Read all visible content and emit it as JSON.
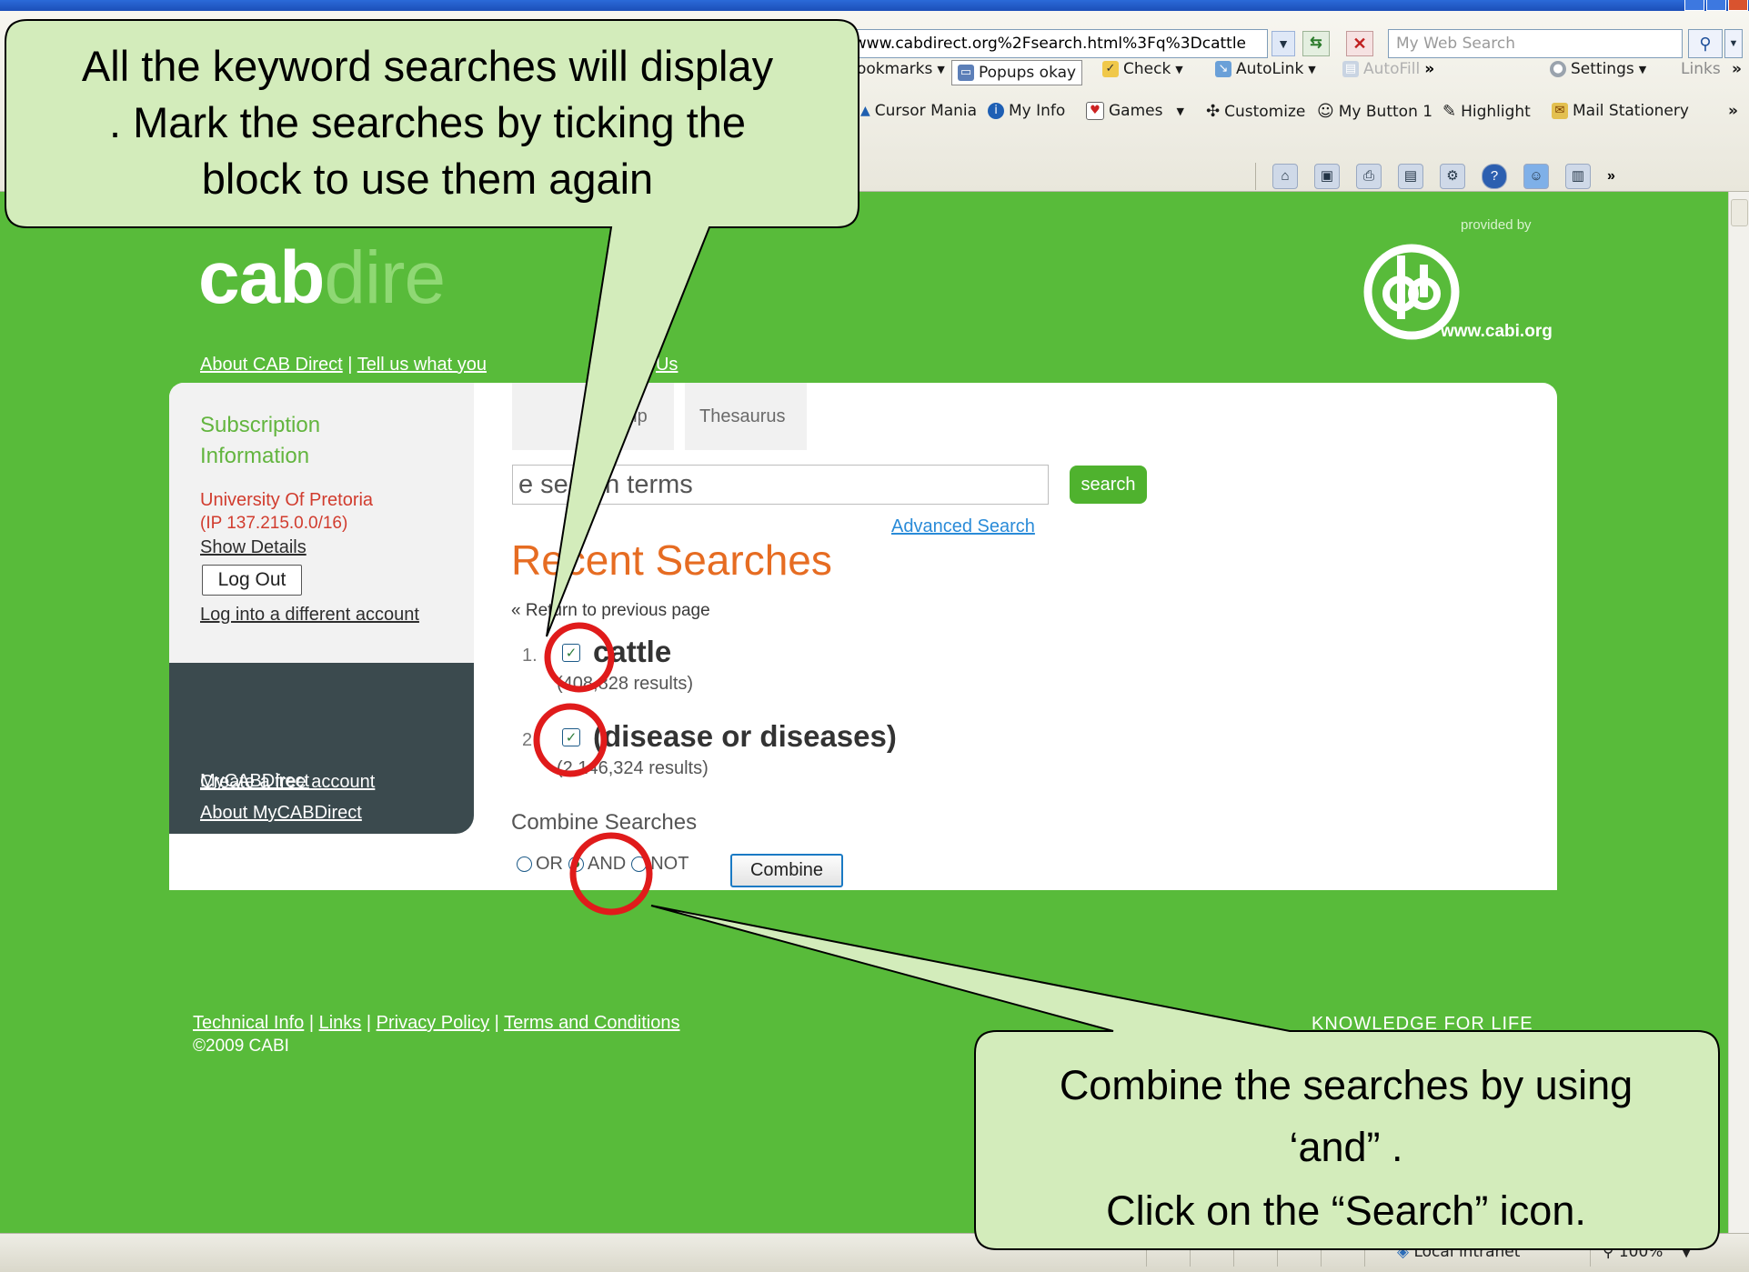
{
  "browser": {
    "address_url": "Fwww.cabdirect.org%2Fsearch.html%3Fq%3Dcattle",
    "web_search_placeholder": "My Web Search",
    "toolbar_row1": {
      "bookmarks": "ookmarks",
      "popups": "Popups okay",
      "check": "Check",
      "autolink": "AutoLink",
      "autofill": "AutoFill",
      "settings": "Settings",
      "links": "Links"
    },
    "toolbar_row2": {
      "cursor_mania": "Cursor Mania",
      "my_info": "My Info",
      "games": "Games",
      "customize": "Customize",
      "my_button": "My Button 1",
      "highlight": "Highlight",
      "mail_stationery": "Mail Stationery"
    },
    "status": {
      "zone": "Local intranet",
      "zoom": "100%"
    }
  },
  "site": {
    "logo_cab": "cab",
    "logo_direct": "dire",
    "provided_by": "provided by",
    "cabi_url": "www.cabi.org",
    "top_nav": {
      "about": "About CAB Direct",
      "tell": "Tell us what you",
      "tail": "Us"
    },
    "sidebar": {
      "subscription_line1": "Subscription",
      "subscription_line2": "Information",
      "institution": "University Of Pretoria",
      "ip": "(IP 137.215.0.0/16)",
      "show_details": "Show Details",
      "log_out": "Log Out",
      "log_into_different": "Log into a different account",
      "mycabdirect": "MyCABDirect",
      "about_mycabdirect": "About MyCABDirect",
      "create_account": "Create a free account"
    },
    "tabs": {
      "help": "elp",
      "thesaurus": "Thesaurus"
    },
    "search": {
      "input_value": "e    search terms",
      "button": "search",
      "advanced": "Advanced Search"
    },
    "recent": {
      "title": "Recent Searches",
      "return_link": "« Return to previous page",
      "items": [
        {
          "num": "1.",
          "term": "cattle",
          "results": "(408,828 results)",
          "checked": true
        },
        {
          "num": "2.",
          "term": "(disease or diseases)",
          "results": "(2,146,324 results)",
          "checked": true
        }
      ],
      "combine_label": "Combine Searches",
      "options": [
        "OR",
        "AND",
        "NOT"
      ],
      "selected_option": "AND",
      "combine_button": "Combine"
    },
    "footer": {
      "technical": "Technical Info",
      "links": "Links",
      "privacy": "Privacy Policy",
      "terms": "Terms and Conditions",
      "copyright": "©2009 CABI",
      "tagline": "KNOWLEDGE FOR LIFE"
    }
  },
  "annotations": {
    "callout_top": {
      "line1": "All the keyword searches will display",
      "line2": ". Mark the searches by ticking the",
      "line3": "block to use them again"
    },
    "callout_bottom": {
      "line1": "Combine the searches by using",
      "line2": "‘and” .",
      "line3": "Click on the “Search” icon."
    },
    "colors": {
      "callout_fill": "#d3ecbb",
      "highlight_circle": "#e01b1b"
    }
  },
  "colors": {
    "page_green": "#58bb3a",
    "title_orange": "#e66c22",
    "search_button_green": "#4fb22e",
    "sidebar_dark": "#3b4a4e",
    "institution_red": "#d13c2e"
  }
}
